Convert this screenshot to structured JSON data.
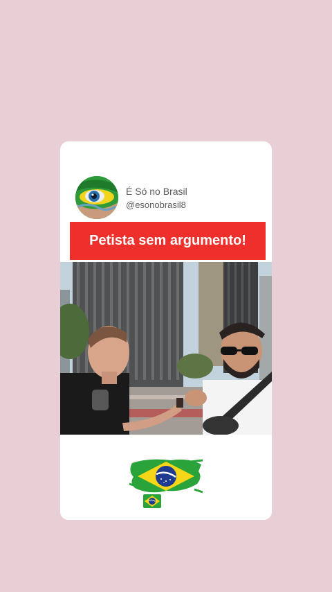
{
  "account": {
    "name": "É Só no Brasil",
    "handle": "@esonobrasil8",
    "avatar_icon": "brazil-flag-eye-avatar"
  },
  "post": {
    "headline": "Petista sem argumento!",
    "headline_bg": "#ef2f2c",
    "media": "video-frame-street-interview"
  },
  "footer": {
    "big_flag_icon": "brazil-flag-brushstroke-icon",
    "small_flag_icon": "brazil-flag-emoji-icon"
  },
  "colors": {
    "page_bg": "#e8cfd6",
    "card_bg": "#ffffff",
    "brazil_green": "#2aa43a",
    "brazil_yellow": "#f6d619",
    "brazil_blue": "#1f3b8f"
  }
}
